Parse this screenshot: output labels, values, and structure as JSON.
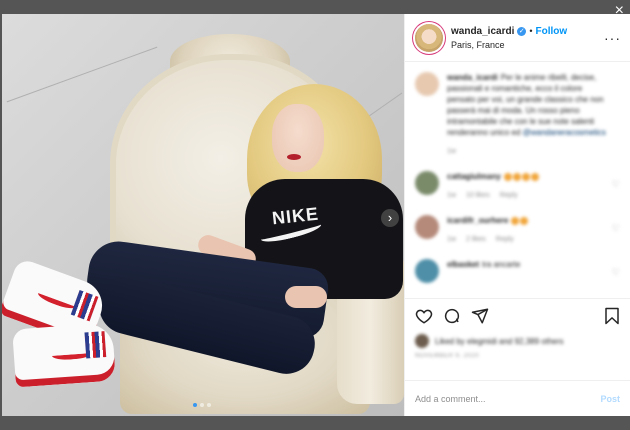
{
  "close_label": "×",
  "photo": {
    "shirt_logo": "NIKE",
    "next_arrow": "›",
    "dots": [
      true,
      false,
      false
    ]
  },
  "header": {
    "username": "wanda_icardi",
    "verified_glyph": "✓",
    "separator": "•",
    "follow_label": "Follow",
    "location": "Paris, France",
    "more_glyph": "···"
  },
  "caption": {
    "username": "wanda_icardi",
    "text": "Per le anime ribelli, decise, passionali e romantiche, ecco il colore pensato per voi, un grande classico che non passerà mai di moda. Un rosso pieno intramontabile che con le sue note salenti renderanno unico ed ",
    "mention": "@wandaneracosmetics",
    "time": "1w"
  },
  "comments": [
    {
      "username": "cattagiulmany",
      "text": "",
      "emoji_count": 4,
      "time": "1w",
      "likes": "10 likes",
      "reply": "Reply"
    },
    {
      "username": "icardifr_ourhere",
      "text": "",
      "emoji_count": 2,
      "time": "1w",
      "likes": "2 likes",
      "reply": "Reply"
    },
    {
      "username": "elbasket",
      "text": "tra ancarte",
      "emoji_count": 0,
      "time": "",
      "likes": "",
      "reply": ""
    }
  ],
  "actions": {
    "likes_text": "Liked by elegmidi and 92,389 others",
    "date": "NOVEMBER 9, 2020"
  },
  "comment_bar": {
    "placeholder": "Add a comment...",
    "post_label": "Post"
  },
  "colors": {
    "accent": "#0095f6",
    "post_disabled": "#b3dbff",
    "text": "#262626",
    "muted": "#8e8e8e"
  }
}
